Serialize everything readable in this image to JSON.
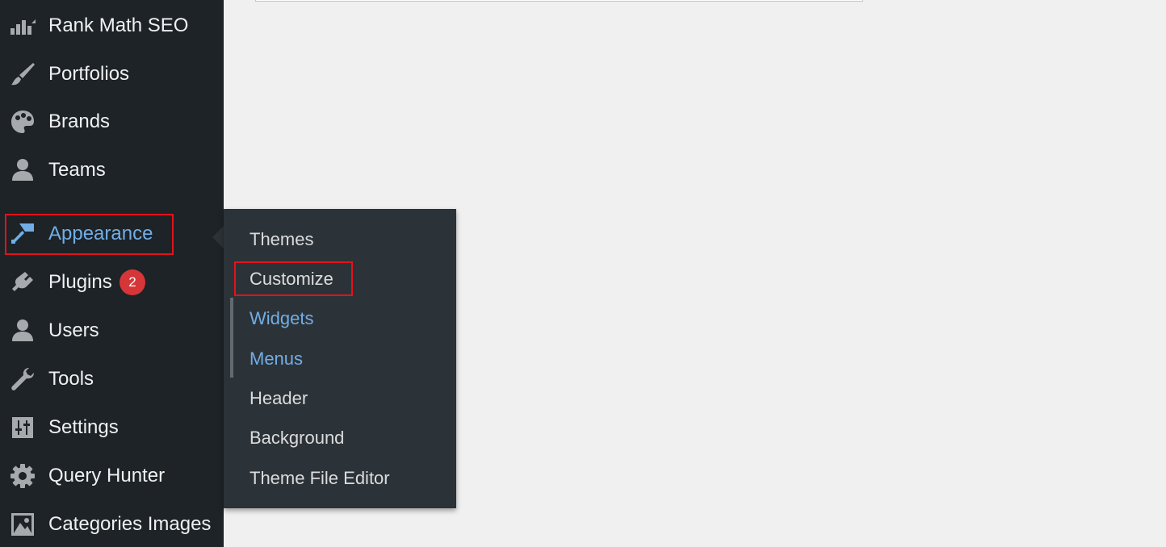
{
  "sidebar": {
    "items": [
      {
        "label": "Rank Math SEO",
        "icon": "rank-math-icon"
      },
      {
        "label": "Portfolios",
        "icon": "brush-icon"
      },
      {
        "label": "Brands",
        "icon": "palette-icon"
      },
      {
        "label": "Teams",
        "icon": "user-icon"
      },
      {
        "label": "Appearance",
        "icon": "paint-roller-icon",
        "current": true
      },
      {
        "label": "Plugins",
        "icon": "plugin-icon",
        "badge": "2"
      },
      {
        "label": "Users",
        "icon": "user-icon"
      },
      {
        "label": "Tools",
        "icon": "wrench-icon"
      },
      {
        "label": "Settings",
        "icon": "sliders-icon"
      },
      {
        "label": "Query Hunter",
        "icon": "gear-icon"
      },
      {
        "label": "Categories Images",
        "icon": "image-icon"
      }
    ]
  },
  "submenu": {
    "items": [
      {
        "label": "Themes"
      },
      {
        "label": "Customize",
        "highlighted": true
      },
      {
        "label": "Widgets"
      },
      {
        "label": "Menus"
      },
      {
        "label": "Header"
      },
      {
        "label": "Background"
      },
      {
        "label": "Theme File Editor"
      }
    ]
  },
  "colors": {
    "sidebar_bg": "#1d2327",
    "submenu_bg": "#2c3338",
    "accent": "#72aee6",
    "badge": "#d63638",
    "highlight_box": "#e4121b"
  }
}
